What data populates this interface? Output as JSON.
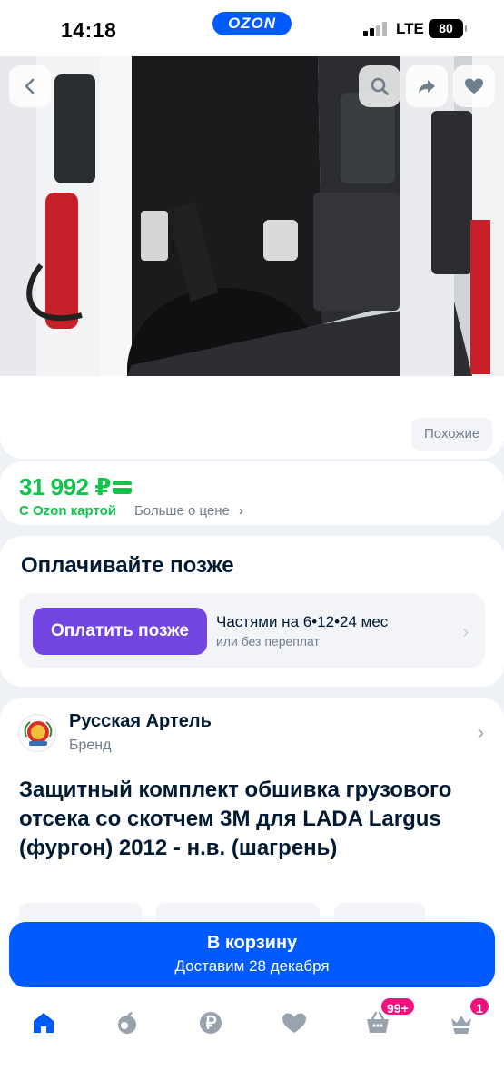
{
  "status_bar": {
    "time": "14:18",
    "network": "LTE",
    "battery": "80",
    "brand_pill": "OZON"
  },
  "hero": {
    "similar_label": "Похожие"
  },
  "price": {
    "value": "31 992 ₽",
    "ozon_card_label": "С Ozon картой",
    "more_label": "Больше о цене",
    "more_chevron": "›"
  },
  "pay_later": {
    "title": "Оплачивайте позже",
    "button_label": "Оплатить позже",
    "parts_label": "Частями на 6•12•24 мес",
    "sub_label": "или без переплат",
    "chevron": "›"
  },
  "brand": {
    "name": "Русская Артель",
    "sub": "Бренд",
    "chevron": "›"
  },
  "product": {
    "title": "Защитный комплект обшивка грузового отсека со скотчем 3М для LADA Largus (фургон) 2012 - н.в. (шагрень)"
  },
  "cart": {
    "label": "В корзину",
    "delivery": "Доставим 28 декабря"
  },
  "tabbar": {
    "items": [
      {
        "icon": "home-icon",
        "active": true
      },
      {
        "icon": "fresh-icon"
      },
      {
        "icon": "ruble-icon"
      },
      {
        "icon": "heart-icon"
      },
      {
        "icon": "basket-icon",
        "badge": "99+"
      },
      {
        "icon": "profile-crown-icon",
        "badge": "1"
      }
    ]
  },
  "colors": {
    "accent": "#005bff",
    "price_green": "#10c44c",
    "pay_purple": "#7245e0",
    "badge_pink": "#f1117e"
  }
}
